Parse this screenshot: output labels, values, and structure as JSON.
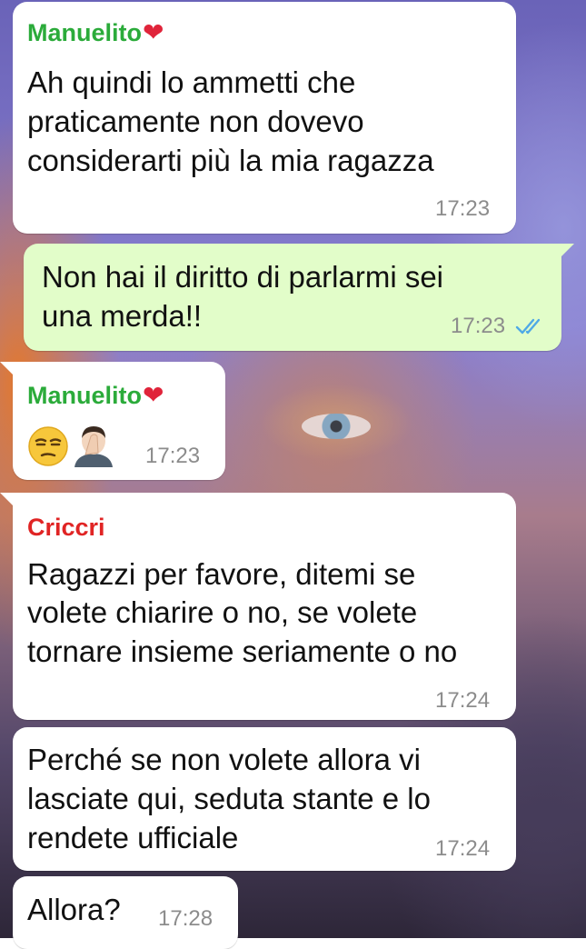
{
  "messages": [
    {
      "sender": "Manuelito",
      "sender_heart": "❤",
      "lines": [
        "Ah quindi lo ammetti che",
        "praticamente non dovevo",
        "considerarti più la mia ragazza"
      ],
      "time": "17:23",
      "direction": "incoming"
    },
    {
      "lines": [
        "Non hai il diritto di parlarmi sei",
        "una merda!!"
      ],
      "time": "17:23",
      "direction": "outgoing",
      "status_icon": "double-check-read-icon"
    },
    {
      "sender": "Manuelito",
      "sender_heart": "❤",
      "emojis": [
        "unamused-face-icon",
        "man-facepalming-icon"
      ],
      "time": "17:23",
      "direction": "incoming"
    },
    {
      "sender": "Criccri",
      "lines": [
        "Ragazzi per favore, ditemi se",
        "volete chiarire o no, se volete",
        "tornare insieme seriamente o no"
      ],
      "time": "17:24",
      "direction": "incoming"
    },
    {
      "lines": [
        "Perché se non volete allora vi",
        "lasciate qui, seduta stante e lo",
        "rendete ufficiale"
      ],
      "time": "17:24",
      "direction": "incoming"
    },
    {
      "lines": [
        "Allora?"
      ],
      "time": "17:28",
      "direction": "incoming"
    }
  ],
  "colors": {
    "incoming_bubble": "#ffffff",
    "outgoing_bubble": "#e2fdc9",
    "sender_manuelito": "#2bab3a",
    "sender_criccri": "#e02424",
    "heart": "#e0243a",
    "read_ticks": "#4fa9e6",
    "timestamp": "#8c8c8c"
  }
}
